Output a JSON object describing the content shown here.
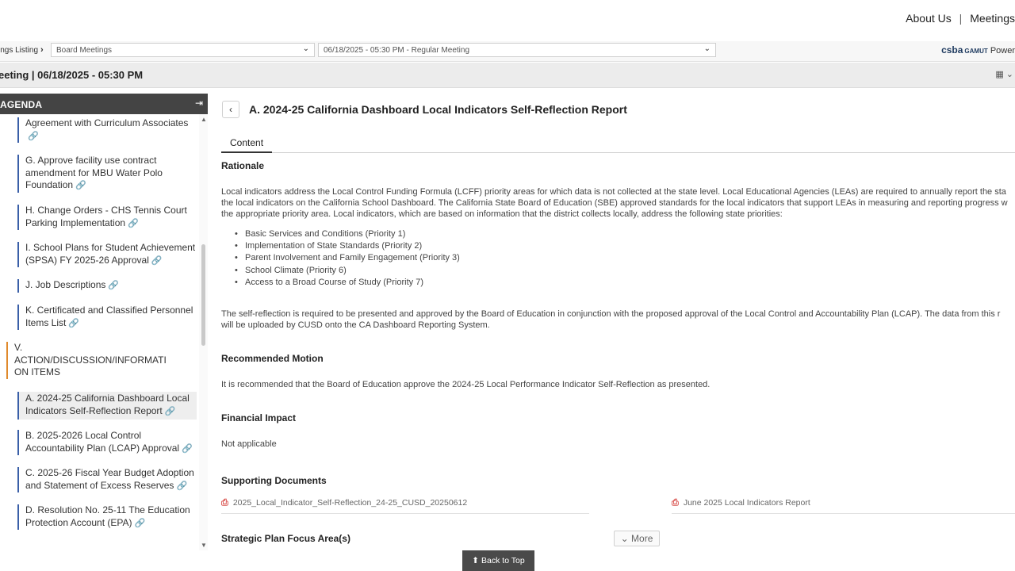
{
  "topnav": {
    "about": "About Us",
    "separator": "|",
    "meetings": "Meetings"
  },
  "breadcrumb": {
    "listing": "ings Listing",
    "category_select": "Board Meetings",
    "meeting_select": "06/18/2025 - 05:30 PM - Regular Meeting"
  },
  "brand": {
    "csba": "csba",
    "gamut": "GAMUT",
    "powered": "Power"
  },
  "titlebar": {
    "title": "eeting | 06/18/2025 - 05:30 PM"
  },
  "sidebar": {
    "heading": "AGENDA",
    "items": [
      {
        "text": "Agreement with Curriculum Associates"
      },
      {
        "text": "G. Approve facility use contract amendment for MBU Water Polo Foundation"
      },
      {
        "text": "H. Change Orders - CHS Tennis Court Parking Implementation"
      },
      {
        "text": "I. School Plans for Student Achievement (SPSA) FY 2025-26 Approval"
      },
      {
        "text": "J. Job Descriptions"
      },
      {
        "text": "K. Certificated and Classified Personnel Items List"
      },
      {
        "text": "V. ACTION/DISCUSSION/INFORMATI ON ITEMS"
      },
      {
        "text": "A. 2024-25 California Dashboard Local Indicators Self-Reflection Report"
      },
      {
        "text": "B. 2025-2026 Local Control Accountability Plan (LCAP) Approval"
      },
      {
        "text": "C. 2025-26 Fiscal Year Budget Adoption and Statement of Excess Reserves"
      },
      {
        "text": "D. Resolution No. 25-11 The Education Protection Account (EPA)"
      }
    ]
  },
  "main": {
    "item_title": "A. 2024-25 California Dashboard Local Indicators Self-Reflection Report",
    "tab_content": "Content",
    "rationale_heading": "Rationale",
    "rationale_p1_l1": "Local indicators address the Local Control Funding Formula (LCFF) priority areas for which data is not collected at the state level.  Local Educational Agencies (LEAs) are required to annually report the sta",
    "rationale_p1_l2": "the local indicators on the California School Dashboard.  The California State Board of Education (SBE) approved standards for the local indicators that support LEAs in measuring and reporting progress w",
    "rationale_p1_l3": "the appropriate priority area.  Local indicators, which are based on information that the district collects locally, address the following state priorities:",
    "priorities": [
      "Basic Services and Conditions (Priority 1)",
      "Implementation of State Standards (Priority 2)",
      "Parent Involvement and Family Engagement (Priority 3)",
      "School Climate (Priority 6)",
      "Access to a Broad Course of Study (Priority 7)"
    ],
    "rationale_p2_l1": "The self-reflection is required to be presented and approved by the Board of Education in conjunction with the proposed approval of the Local Control and Accountability Plan (LCAP). The data from this r",
    "rationale_p2_l2": "will be uploaded by CUSD onto the CA Dashboard Reporting System.",
    "motion_heading": "Recommended Motion",
    "motion_text": "It is recommended that the Board of Education approve the 2024-25 Local Performance Indicator Self-Reflection as presented.",
    "financial_heading": "Financial Impact",
    "financial_text": "Not applicable",
    "docs_heading": "Supporting Documents",
    "doc1": "2025_Local_Indicator_Self-Reflection_24-25_CUSD_20250612",
    "doc2": "June 2025 Local Indicators Report",
    "strategic_heading": "Strategic Plan Focus Area(s)",
    "more_label": "More"
  },
  "back_to_top": "Back to Top",
  "colors": {
    "agenda_header": "#444444",
    "item_bar": "#3a5fa8",
    "section_bar": "#e08a2c",
    "pdf": "#d9534f"
  }
}
